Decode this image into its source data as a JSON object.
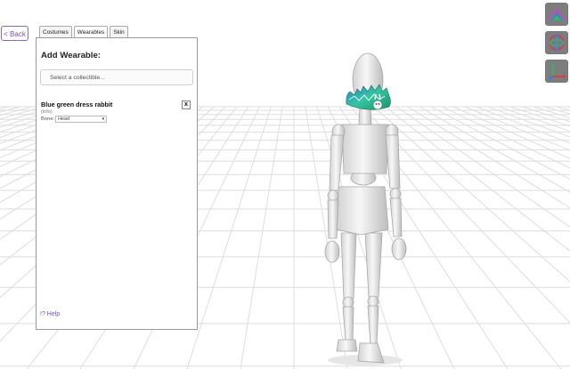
{
  "nav": {
    "back_label": "< Back"
  },
  "tabs": [
    {
      "label": "Costumes",
      "active": false
    },
    {
      "label": "Wearables",
      "active": true
    },
    {
      "label": "Skin",
      "active": false
    }
  ],
  "panel": {
    "title": "Add Wearable:",
    "select_placeholder": "Select a collectible...",
    "item": {
      "title": "Blue green dress rabbit",
      "meta": "(info)",
      "bone_label": "Bone:",
      "bone_value": "Head",
      "remove_label": "x"
    },
    "help_label": "!? Help"
  },
  "toolbar": {
    "icons": [
      "scene-view-icon",
      "rotate-gizmo-icon",
      "move-axis-icon"
    ]
  },
  "colors": {
    "accent": "#7a4fb0",
    "floor_grid": "#dcdcdc",
    "mannequin": "#e9e9e9",
    "wearable": "#2fb39a"
  }
}
